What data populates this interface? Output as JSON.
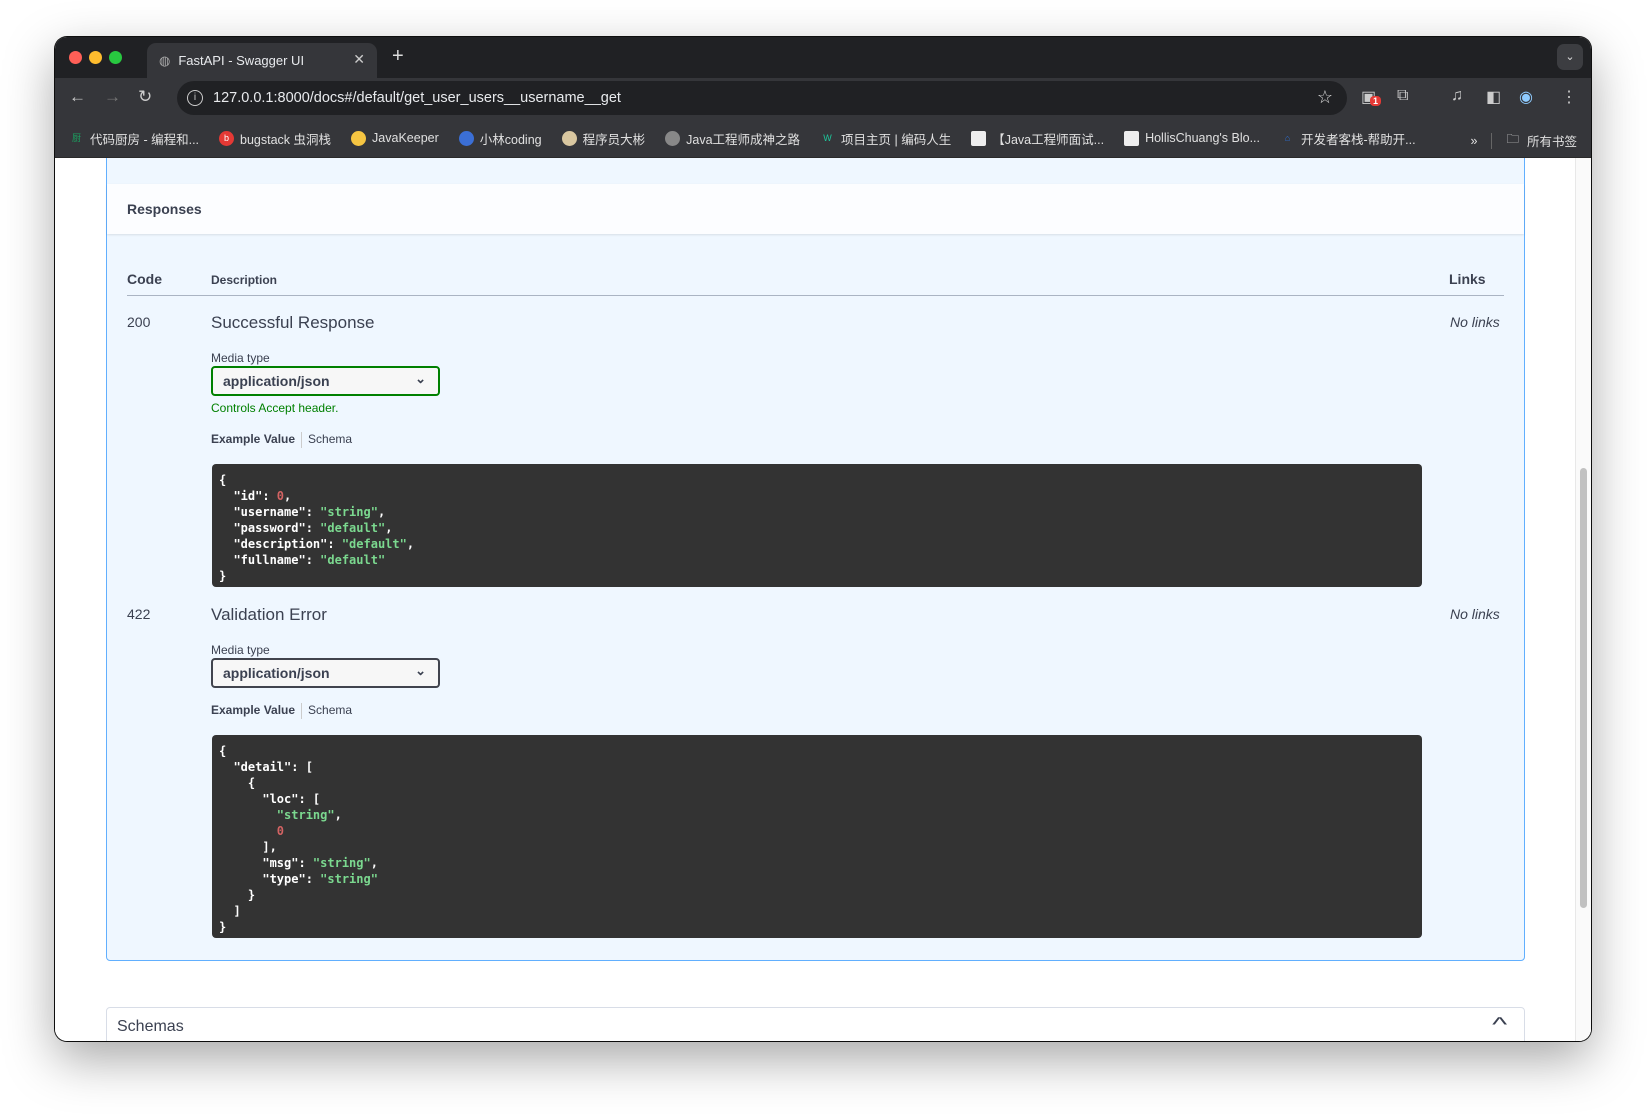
{
  "browser": {
    "tab_title": "FastAPI - Swagger UI",
    "url": "127.0.0.1:8000/docs#/default/get_user_users__username__get",
    "extension_badge": "1",
    "bookmarks": [
      {
        "label": "代码厨房 - 编程和...",
        "icon": "厨",
        "color": "#1aa260"
      },
      {
        "label": "bugstack 虫洞栈",
        "icon": "bug",
        "color": "#e53935"
      },
      {
        "label": "JavaKeeper",
        "icon": "🐤",
        "color": "transparent"
      },
      {
        "label": "小林coding",
        "icon": "●",
        "color": "#3b6fd6"
      },
      {
        "label": "程序员大彬",
        "icon": "▣",
        "color": "#d9c7a0"
      },
      {
        "label": "Java工程师成神之路",
        "icon": "◍",
        "color": "#777"
      },
      {
        "label": "项目主页 | 编码人生",
        "icon": "W",
        "color": "transparent"
      },
      {
        "label": "【Java工程师面试...",
        "icon": "▦",
        "color": "#eee"
      },
      {
        "label": "HollisChuang's Blo...",
        "icon": "✎",
        "color": "#eee"
      },
      {
        "label": "开发者客栈-帮助开...",
        "icon": "⌂",
        "color": "#2d6fd6"
      }
    ],
    "all_bookmarks": "所有书签"
  },
  "responses": {
    "title": "Responses",
    "col_code": "Code",
    "col_description": "Description",
    "col_links": "Links",
    "items": [
      {
        "code": "200",
        "description": "Successful Response",
        "media_label": "Media type",
        "media_value": "application/json",
        "controls": "Controls Accept header.",
        "tab_example": "Example Value",
        "tab_schema": "Schema",
        "links": "No links"
      },
      {
        "code": "422",
        "description": "Validation Error",
        "media_label": "Media type",
        "media_value": "application/json",
        "tab_example": "Example Value",
        "tab_schema": "Schema",
        "links": "No links"
      }
    ]
  },
  "schemas": {
    "title": "Schemas"
  }
}
